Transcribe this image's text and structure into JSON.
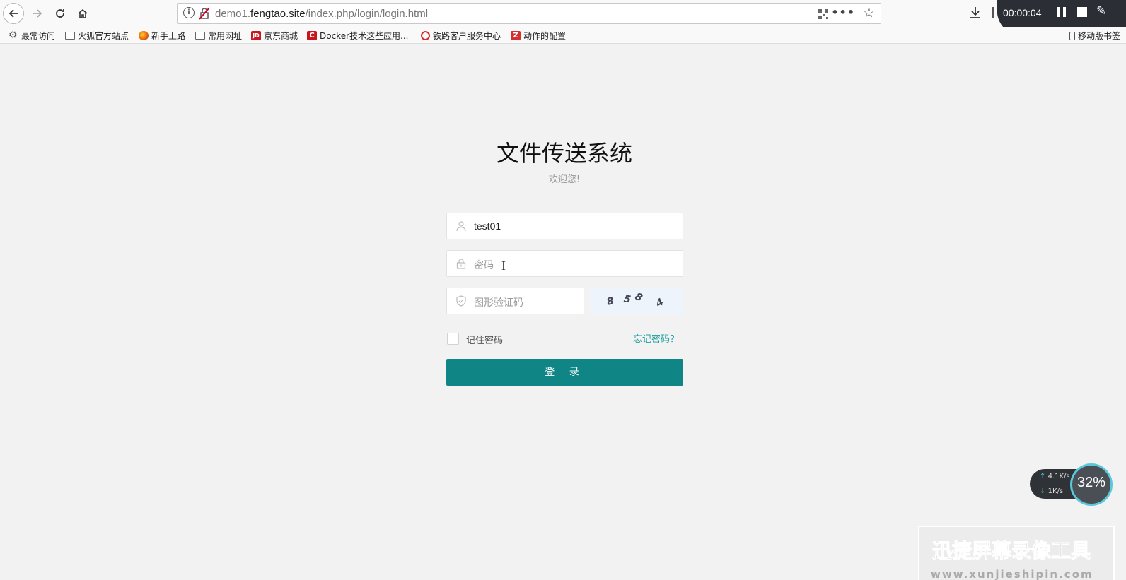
{
  "browser": {
    "url_prefix": "demo1.",
    "url_domain": "fengtao.site",
    "url_path": "/index.php/login/login.html",
    "more_label": "•••"
  },
  "bookmarks": [
    {
      "label": "最常访问",
      "icon": "gear-icon"
    },
    {
      "label": "火狐官方站点",
      "icon": "folder-icon"
    },
    {
      "label": "新手上路",
      "icon": "firefox-icon"
    },
    {
      "label": "常用网址",
      "icon": "folder-icon"
    },
    {
      "label": "京东商城",
      "icon": "jd-icon"
    },
    {
      "label": "Docker技术这些应用...",
      "icon": "c-icon"
    },
    {
      "label": "铁路客户服务中心",
      "icon": "railway-icon"
    },
    {
      "label": "动作的配置",
      "icon": "z-icon"
    },
    {
      "label": "移动版书签",
      "icon": "mobile-icon"
    }
  ],
  "recorder": {
    "time": "00:00:04"
  },
  "login": {
    "title": "文件传送系统",
    "subtitle": "欢迎您!",
    "username_value": "test01",
    "password_placeholder": "密码",
    "captcha_placeholder": "图形验证码",
    "captcha_chars": [
      "8",
      "5",
      "8",
      "4"
    ],
    "remember_label": "记住密码",
    "forgot_label": "忘记密码？",
    "submit_label": "登 录",
    "accent_color": "#0f8685"
  },
  "network": {
    "upload": "4.1K/s",
    "download": "1K/s",
    "percent": "32%"
  },
  "watermark": {
    "title": "迅捷屏幕录像工具",
    "url": "www.xunjieshipin.com"
  }
}
